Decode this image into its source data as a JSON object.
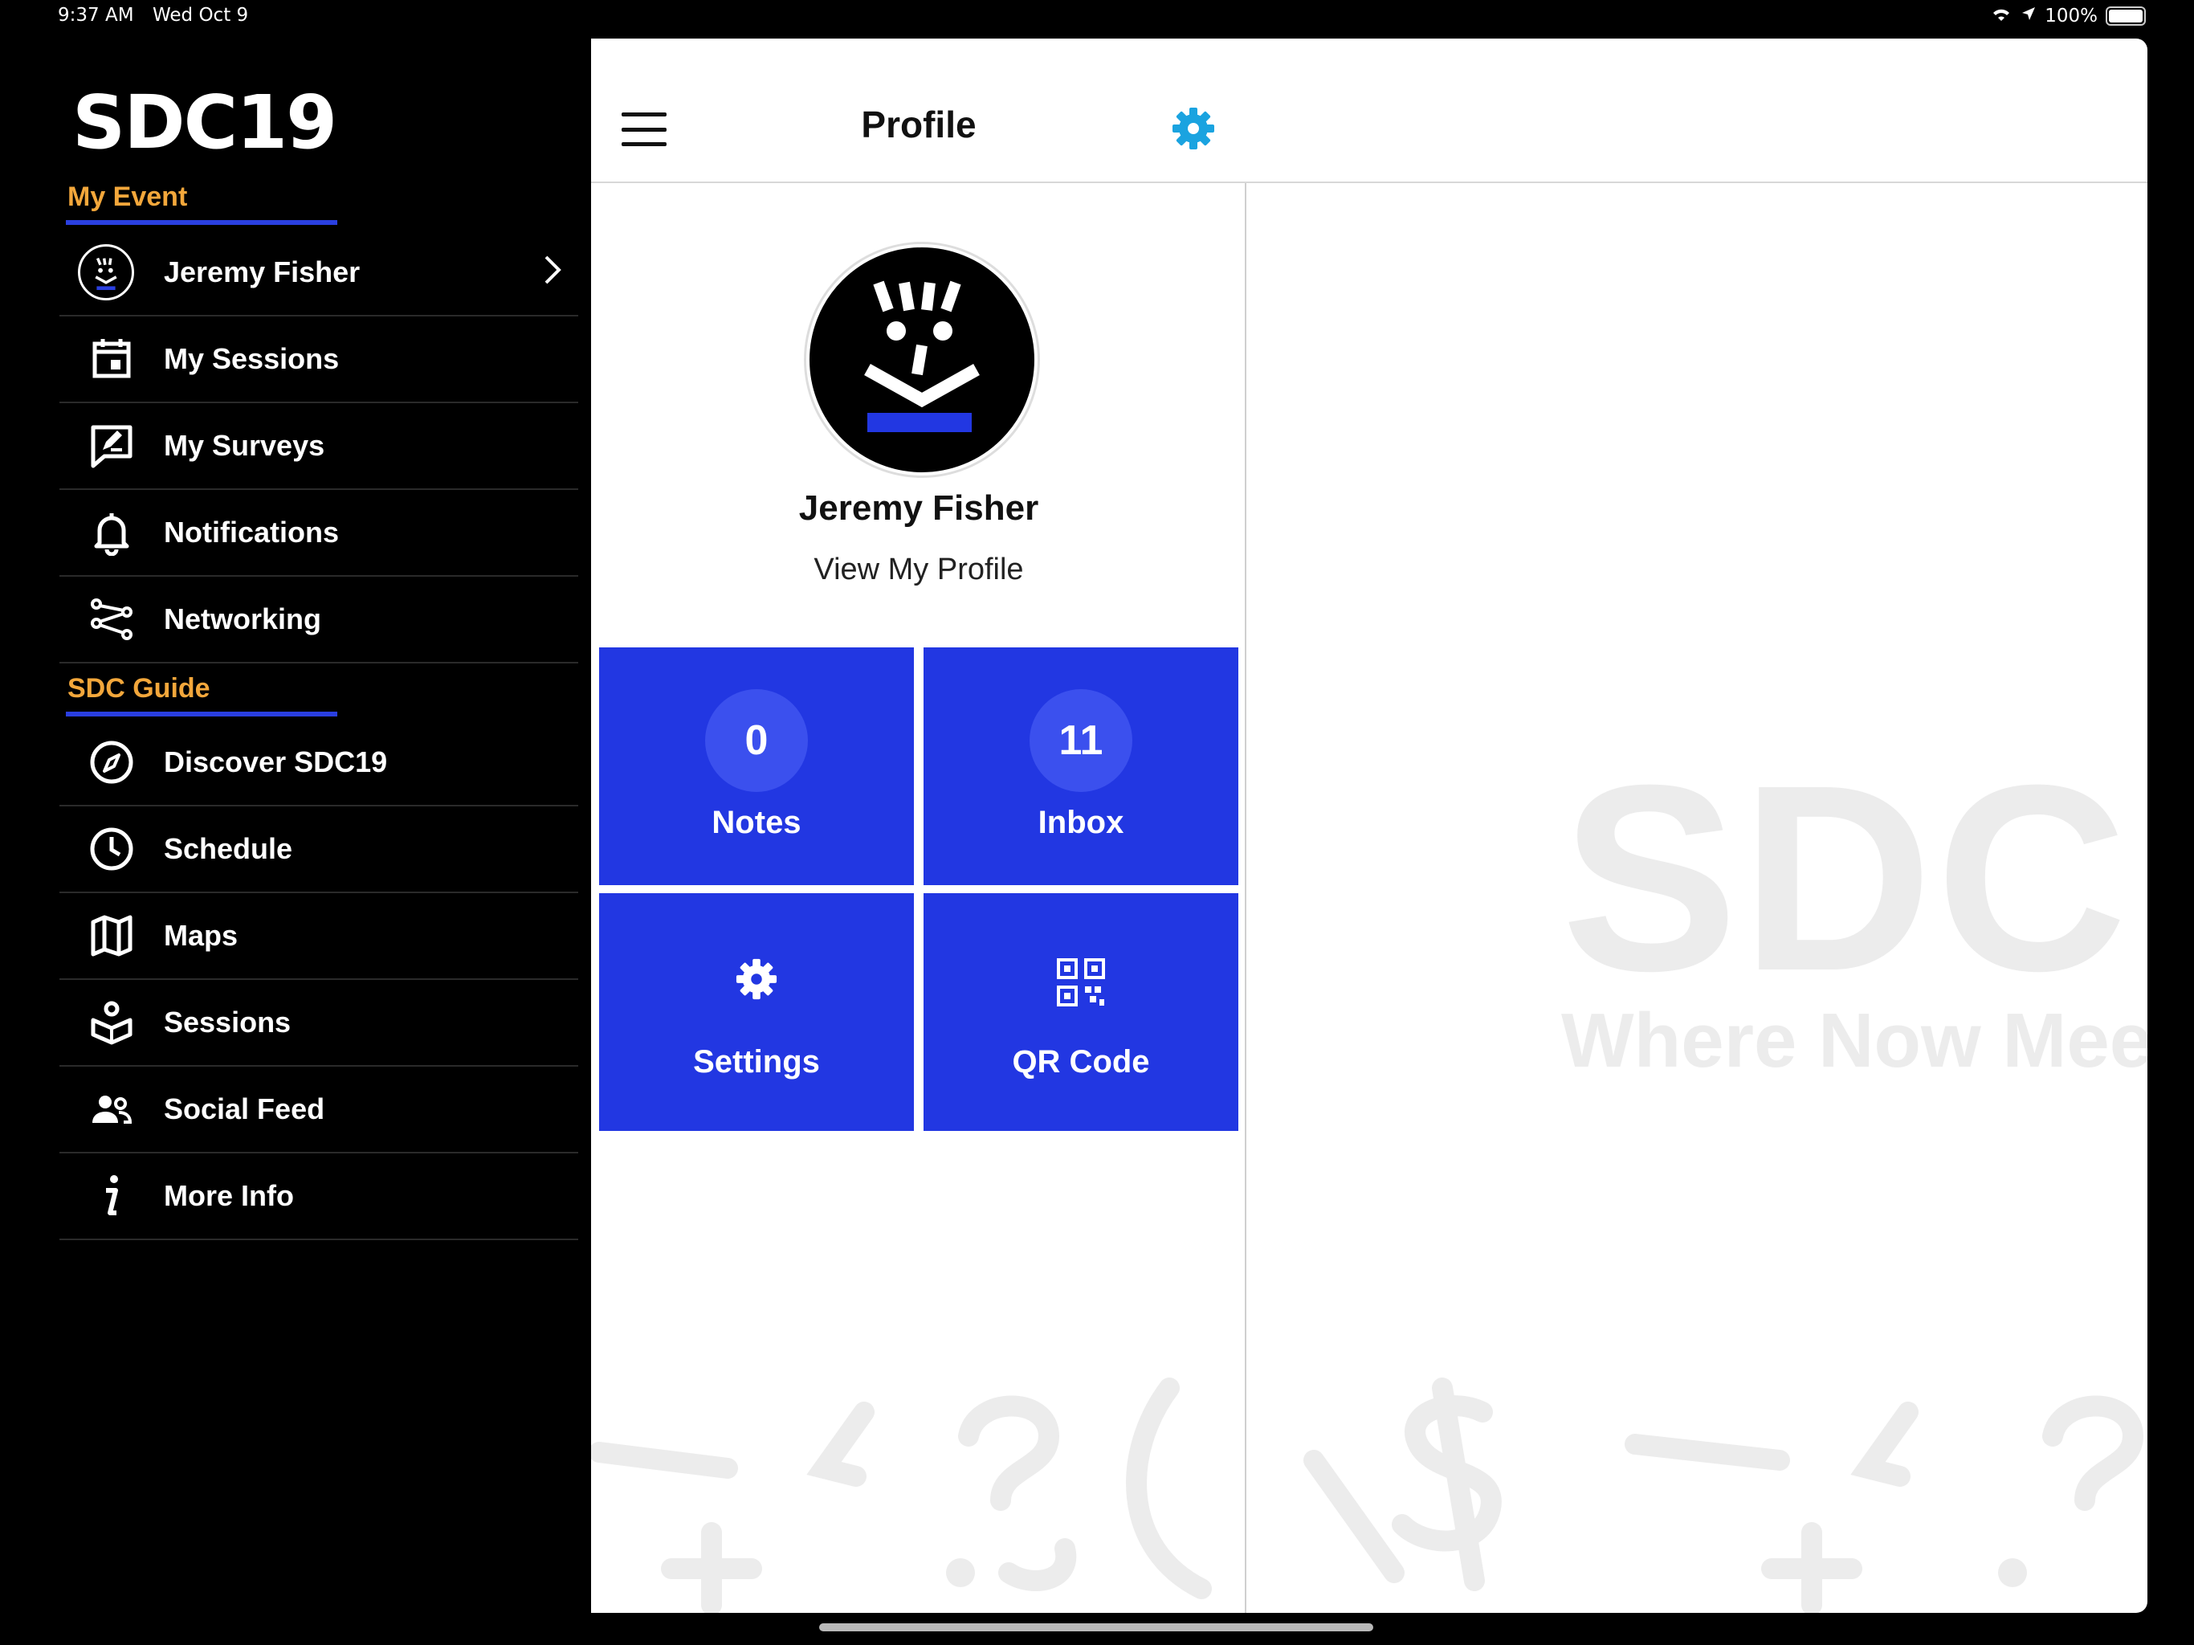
{
  "status": {
    "time": "9:37 AM",
    "date": "Wed Oct 9",
    "battery": "100%"
  },
  "sidebar": {
    "logo": "SDC19",
    "my_event_title": "My Event",
    "user_name": "Jeremy Fisher",
    "my_event_items": [
      {
        "label": "My Sessions",
        "icon": "calendar-icon"
      },
      {
        "label": "My Surveys",
        "icon": "survey-icon"
      },
      {
        "label": "Notifications",
        "icon": "bell-icon"
      },
      {
        "label": "Networking",
        "icon": "networking-icon"
      }
    ],
    "guide_title": "SDC Guide",
    "guide_items": [
      {
        "label": "Discover SDC19",
        "icon": "compass-icon"
      },
      {
        "label": "Schedule",
        "icon": "clock-icon"
      },
      {
        "label": "Maps",
        "icon": "map-icon"
      },
      {
        "label": "Sessions",
        "icon": "sessions-icon"
      },
      {
        "label": "Social Feed",
        "icon": "people-icon"
      },
      {
        "label": "More Info",
        "icon": "info-icon"
      }
    ]
  },
  "profile": {
    "title": "Profile",
    "name": "Jeremy Fisher",
    "view_link": "View My Profile"
  },
  "tiles": {
    "notes_count": "0",
    "notes_label": "Notes",
    "inbox_count": "11",
    "inbox_label": "Inbox",
    "settings_label": "Settings",
    "qr_label": "QR Code"
  },
  "watermark": {
    "big": "SDC",
    "tagline": "Where Now Meet"
  },
  "colors": {
    "accent_blue": "#2237e2",
    "section_orange": "#f3a73b",
    "gear_blue": "#1aa3e0"
  }
}
